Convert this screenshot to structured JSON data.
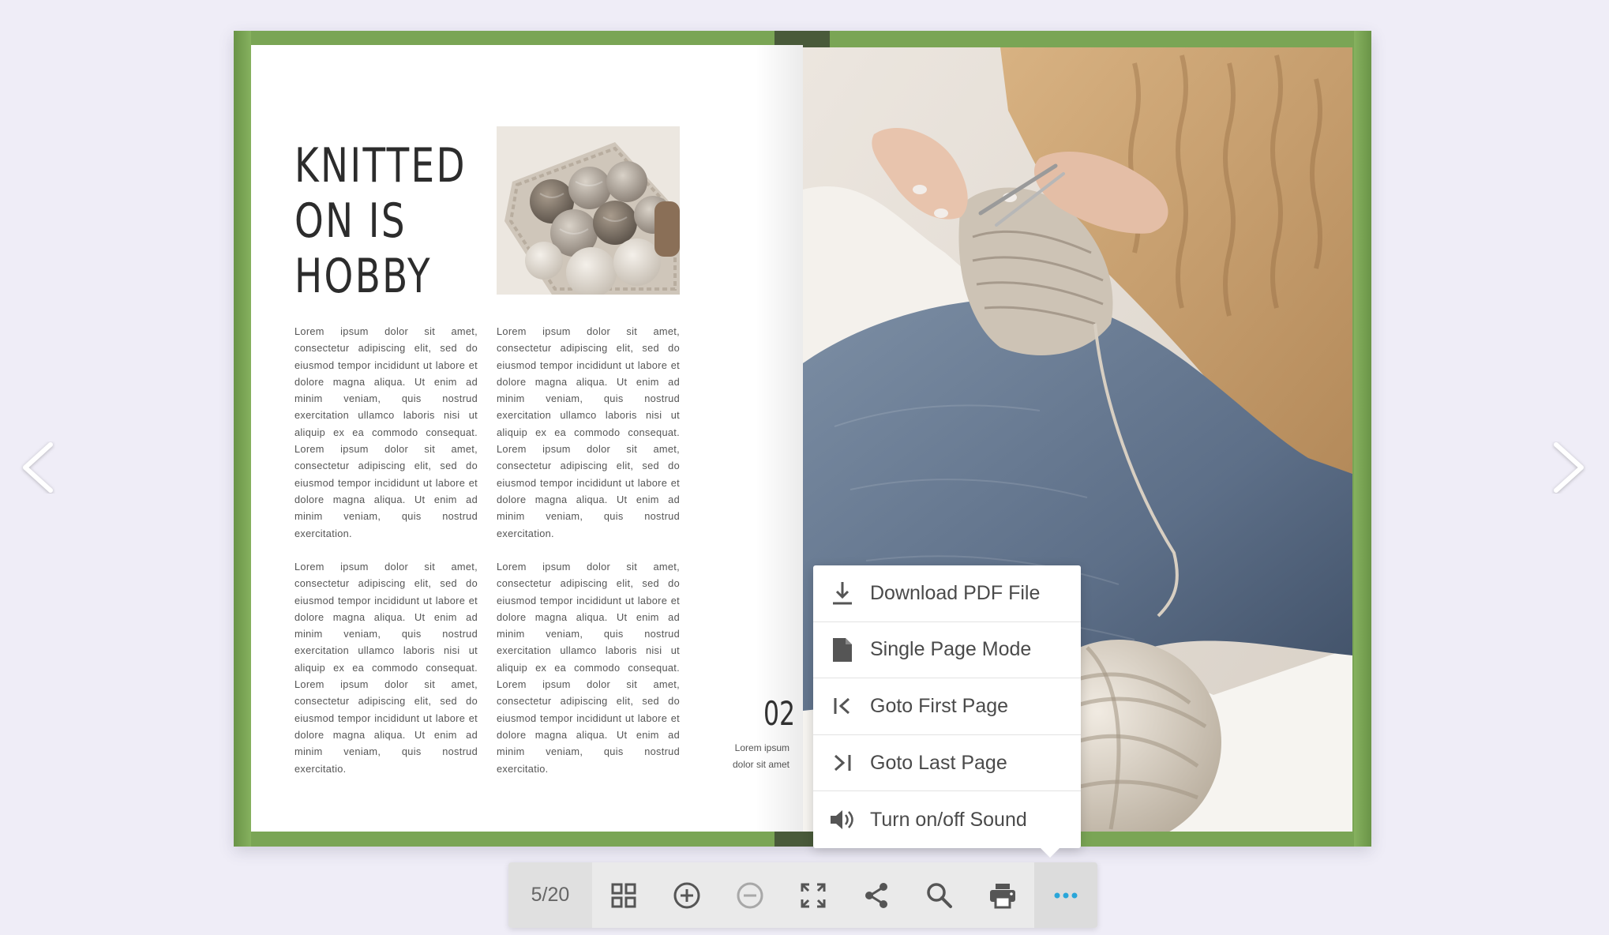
{
  "left_page": {
    "title": "KNITTED\nON IS\nHOBBY",
    "paragraphs": [
      "Lorem ipsum dolor sit amet, consectetur adipiscing elit, sed do eiusmod tempor incididunt ut labore et dolore magna aliqua. Ut enim ad minim veniam, quis nostrud exercitation ullamco laboris nisi ut aliquip ex ea commodo consequat. Lorem ipsum dolor sit amet, consectetur adipiscing elit, sed do eiusmod tempor incididunt ut labore et dolore magna aliqua. Ut enim ad minim veniam, quis nostrud exercitation.",
      "Lorem ipsum dolor sit amet, consectetur adipiscing elit, sed do eiusmod tempor incididunt ut labore et dolore magna aliqua. Ut enim ad minim veniam, quis nostrud exercitation ullamco laboris nisi ut aliquip ex ea commodo consequat. Lorem ipsum dolor sit amet, consectetur adipiscing elit, sed do eiusmod tempor incididunt ut labore et dolore magna aliqua. Ut enim ad minim veniam, quis nostrud exercitation.",
      "Lorem ipsum dolor sit amet, consectetur adipiscing elit, sed do eiusmod tempor incididunt ut labore et dolore magna aliqua. Ut enim ad minim veniam, quis nostrud exercitation ullamco laboris nisi ut aliquip ex ea commodo consequat. Lorem ipsum dolor sit amet, consectetur adipiscing elit, sed do eiusmod tempor incididunt ut labore et dolore magna aliqua. Ut enim ad minim veniam, quis nostrud exercitatio.",
      "Lorem ipsum dolor sit amet, consectetur adipiscing elit, sed do eiusmod tempor incididunt ut labore et dolore magna aliqua. Ut enim ad minim veniam, quis nostrud exercitation ullamco laboris nisi ut aliquip ex ea commodo consequat. Lorem ipsum dolor sit amet, consectetur adipiscing elit, sed do eiusmod tempor incididunt ut labore et dolore magna aliqua. Ut enim ad minim veniam, quis nostrud exercitatio."
    ],
    "page_number": "02",
    "page_caption": "Lorem ipsum\ndolor sit amet"
  },
  "menu": {
    "items": [
      {
        "label": "Download PDF File",
        "icon": "download-icon"
      },
      {
        "label": "Single Page Mode",
        "icon": "document-icon"
      },
      {
        "label": "Goto First Page",
        "icon": "first-page-icon"
      },
      {
        "label": "Goto Last Page",
        "icon": "last-page-icon"
      },
      {
        "label": "Turn on/off Sound",
        "icon": "sound-icon"
      }
    ]
  },
  "toolbar": {
    "page_counter": "5/20",
    "buttons": [
      {
        "icon": "thumbnails-icon"
      },
      {
        "icon": "zoom-in-icon"
      },
      {
        "icon": "zoom-out-icon"
      },
      {
        "icon": "fullscreen-icon"
      },
      {
        "icon": "share-icon"
      },
      {
        "icon": "search-icon"
      },
      {
        "icon": "print-icon"
      },
      {
        "icon": "more-icon"
      }
    ]
  },
  "colors": {
    "cover_green": "#7aa555",
    "spine": "#495a3a",
    "background": "#efedf7",
    "toolbar_bg": "#eaeaea",
    "accent_more": "#2aa6d9",
    "icon_gray": "#555555"
  }
}
